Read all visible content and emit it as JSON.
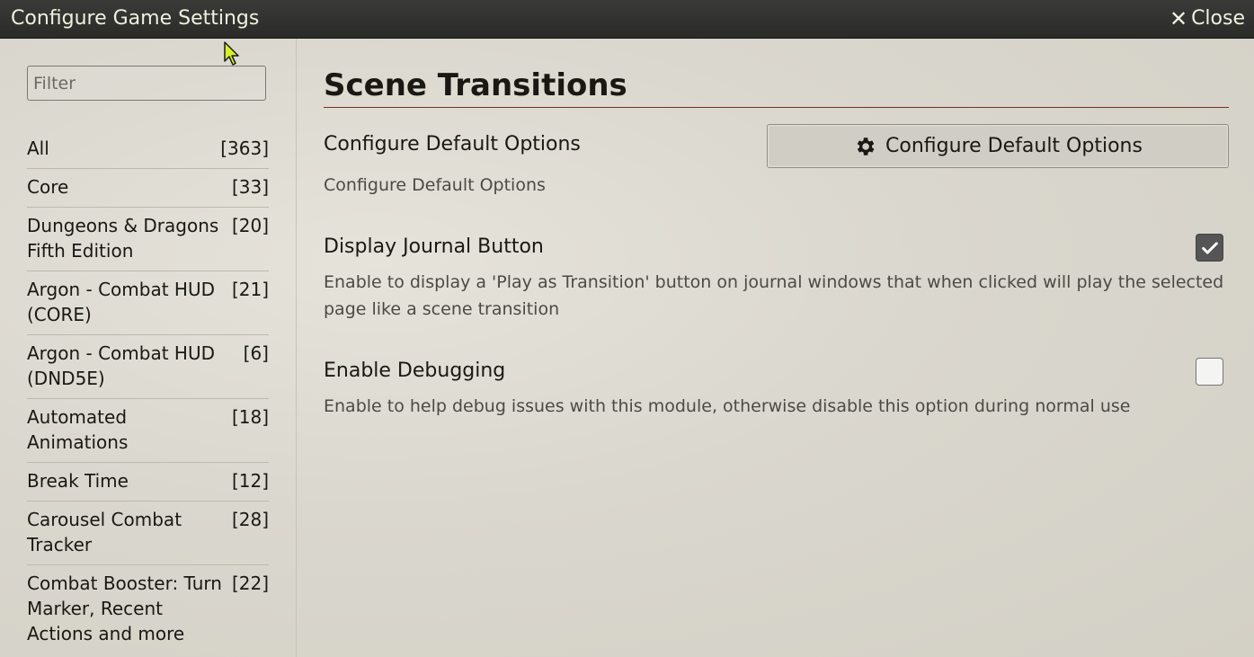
{
  "window": {
    "title": "Configure Game Settings",
    "close_label": "Close",
    "close_icon": "times-icon"
  },
  "sidebar": {
    "filter_placeholder": "Filter",
    "categories": [
      {
        "name": "All",
        "count": "[363]"
      },
      {
        "name": "Core",
        "count": "[33]"
      },
      {
        "name": "Dungeons & Dragons Fifth Edition",
        "count": "[20]"
      },
      {
        "name": "Argon - Combat HUD (CORE)",
        "count": "[21]"
      },
      {
        "name": "Argon - Combat HUD (DND5E)",
        "count": "[6]"
      },
      {
        "name": "Automated Animations",
        "count": "[18]"
      },
      {
        "name": "Break Time",
        "count": "[12]"
      },
      {
        "name": "Carousel Combat Tracker",
        "count": "[28]"
      },
      {
        "name": "Combat Booster: Turn Marker, Recent Actions and more",
        "count": "[22]"
      }
    ]
  },
  "main": {
    "heading": "Scene Transitions",
    "settings": [
      {
        "label": "Configure Default Options",
        "button_label": "Configure Default Options",
        "button_icon": "gear-icon",
        "hint": "Configure Default Options"
      },
      {
        "label": "Display Journal Button",
        "checked": true,
        "hint": "Enable to display a 'Play as Transition' button on journal windows that when clicked will play the selected page like a scene transition"
      },
      {
        "label": "Enable Debugging",
        "checked": false,
        "hint": "Enable to help debug issues with this module, otherwise disable this option during normal use"
      }
    ]
  },
  "colors": {
    "titlebar": "#2e2e2c",
    "heading_rule": "#782e22",
    "checkbox_checked": "#555555"
  }
}
